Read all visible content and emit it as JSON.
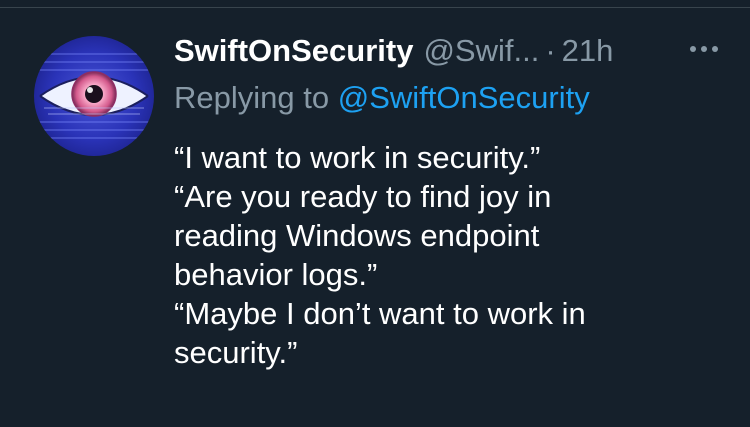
{
  "tweet": {
    "author_name": "SwiftOnSecurity",
    "author_handle": "@Swif...",
    "separator": "·",
    "time": "21h",
    "more_icon": "more-horizontal-icon",
    "reply_prefix": "Replying to",
    "reply_to": "@SwiftOnSecurity",
    "body_lines": [
      "“I want to work in security.”",
      "“Are you ready to find joy in",
      "reading Windows endpoint",
      "behavior logs.”",
      "“Maybe I don’t want to work in",
      "security.”"
    ]
  },
  "colors": {
    "background": "#15202b",
    "primary_text": "#ffffff",
    "secondary_text": "#8899a6",
    "link": "#1da1f2",
    "divider": "#38444d"
  }
}
